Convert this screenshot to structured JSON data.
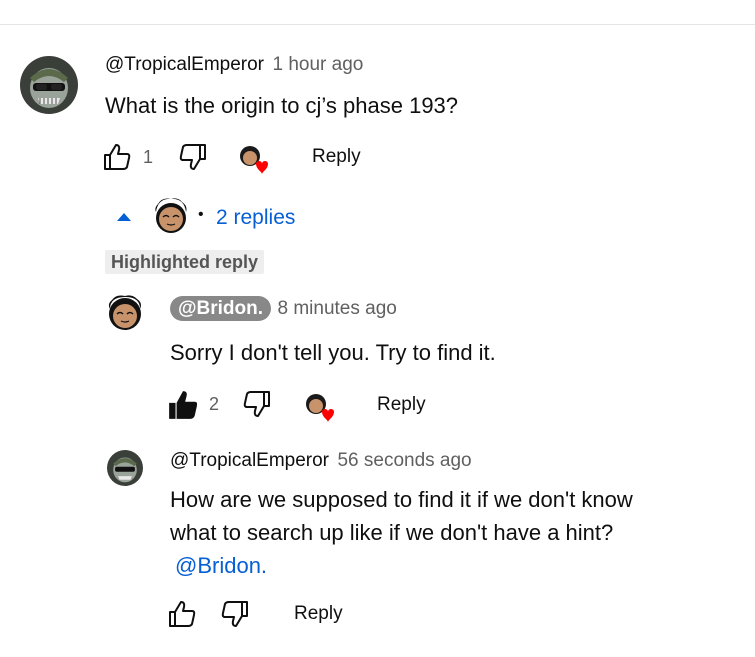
{
  "thread": {
    "top_comment": {
      "author": "@TropicalEmperor",
      "time": "1 hour ago",
      "text": "What is the origin to cj’s phase 193?",
      "like_count": "1",
      "reply_label": "Reply"
    },
    "replies_toggle": {
      "label": "2 replies"
    },
    "highlighted_label": "Highlighted reply",
    "replies": [
      {
        "author": "@Bridon.",
        "time": "8 minutes ago",
        "text": "Sorry I don't tell you. Try to find it.",
        "like_count": "2",
        "reply_label": "Reply"
      },
      {
        "author": "@TropicalEmperor",
        "time": "56 seconds ago",
        "text_line1": "How are we supposed to find it if we don't know",
        "text_line2": "what to search up like if we don't have a hint?",
        "mention": "@Bridon.",
        "reply_label": "Reply"
      }
    ]
  },
  "icons": {
    "like": "thumbs-up-icon",
    "dislike": "thumbs-down-icon",
    "creator_heart": "creator-heart-icon",
    "collapse": "caret-up-icon"
  },
  "colors": {
    "link_blue": "#065fd4",
    "heart_red": "#ff0000",
    "pill_gray": "#888888"
  }
}
